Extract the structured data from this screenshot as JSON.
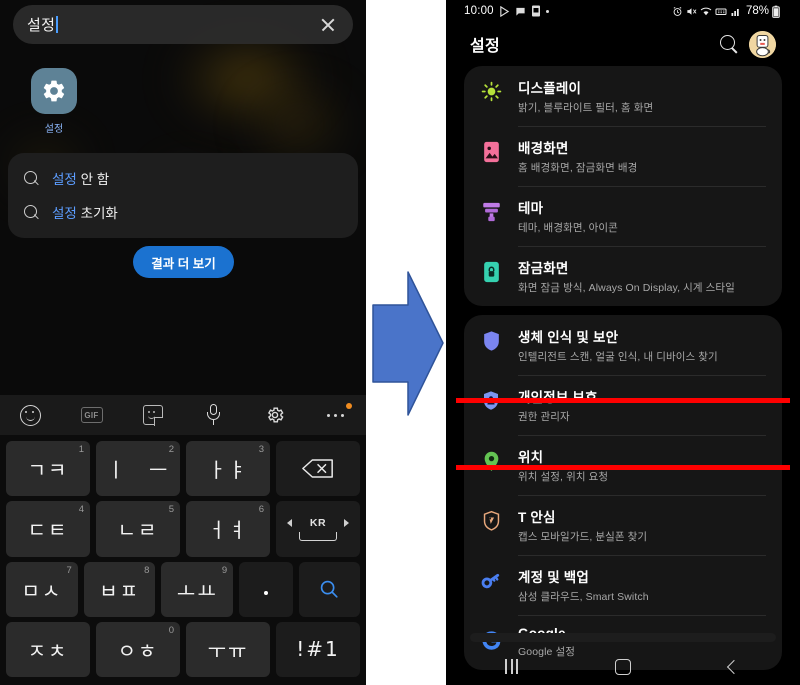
{
  "left_panel": {
    "search": {
      "value": "설정",
      "clear_icon": "close-icon"
    },
    "app_result": {
      "label": "설정",
      "icon": "gear-icon"
    },
    "suggestions": [
      {
        "icon": "search-icon",
        "highlight": "설정",
        "rest": " 안 함"
      },
      {
        "icon": "search-icon",
        "highlight": "설정",
        "rest": " 초기화"
      }
    ],
    "more_button": "결과 더 보기",
    "toolbar": [
      {
        "icon": "emoji-smile-icon",
        "label": ""
      },
      {
        "icon": "gif-icon",
        "label": "GIF"
      },
      {
        "icon": "sticker-icon",
        "label": ""
      },
      {
        "icon": "microphone-icon",
        "label": ""
      },
      {
        "icon": "gear-icon",
        "label": ""
      },
      {
        "icon": "more-options-icon",
        "label": ""
      }
    ],
    "keyboard": {
      "rows": [
        [
          {
            "glyph": "ㄱㅋ",
            "num": "1",
            "type": "char"
          },
          {
            "glyph": "ㅣ　ㅡ",
            "num": "2",
            "type": "char"
          },
          {
            "glyph": "ㅏㅑ",
            "num": "3",
            "type": "char"
          },
          {
            "glyph": "",
            "num": "",
            "type": "backspace"
          }
        ],
        [
          {
            "glyph": "ㄷㅌ",
            "num": "4",
            "type": "char"
          },
          {
            "glyph": "ㄴㄹ",
            "num": "5",
            "type": "char"
          },
          {
            "glyph": "ㅓㅕ",
            "num": "6",
            "type": "char"
          },
          {
            "glyph": "KR",
            "num": "",
            "type": "space"
          }
        ],
        [
          {
            "glyph": "ㅁㅅ",
            "num": "7",
            "type": "char"
          },
          {
            "glyph": "ㅂㅍ",
            "num": "8",
            "type": "char"
          },
          {
            "glyph": "ㅗㅛ",
            "num": "9",
            "type": "char"
          },
          {
            "glyph": ".",
            "num": "",
            "type": "period"
          },
          {
            "glyph": "",
            "num": "",
            "type": "search"
          }
        ],
        [
          {
            "glyph": "ㅈㅊ",
            "num": "",
            "type": "char"
          },
          {
            "glyph": "ㅇㅎ",
            "num": "0",
            "type": "char"
          },
          {
            "glyph": "ㅜㅠ",
            "num": "",
            "type": "char"
          },
          {
            "glyph": "!#1",
            "num": "",
            "type": "symbols"
          }
        ]
      ]
    }
  },
  "arrow": {
    "name": "right-arrow",
    "color": "#4a74c9"
  },
  "right_panel": {
    "status_bar": {
      "time": "10:00",
      "left_icons": [
        "play-store-icon",
        "message-icon",
        "sim-card-icon",
        "dot-icon"
      ],
      "right_icons": [
        "alarm-icon",
        "mute-icon",
        "wifi-icon",
        "network-icon",
        "signal-icon"
      ],
      "battery_percent": "78%",
      "battery_icon": "battery-icon"
    },
    "header": {
      "title": "설정",
      "search_icon": "search-icon",
      "avatar": "user-avatar"
    },
    "groups": [
      {
        "items": [
          {
            "icon": "brightness-icon",
            "color": "#b6e23a",
            "title": "디스플레이",
            "subtitle": "밝기, 블루라이트 필터, 홈 화면"
          },
          {
            "icon": "wallpaper-icon",
            "color": "#f4709a",
            "title": "배경화면",
            "subtitle": "홈 배경화면, 잠금화면 배경"
          },
          {
            "icon": "theme-icon",
            "color": "#c07be8",
            "title": "테마",
            "subtitle": "테마, 배경화면, 아이콘"
          },
          {
            "icon": "lock-icon",
            "color": "#35d1b0",
            "title": "잠금화면",
            "subtitle": "화면 잠금 방식, Always On Display, 시계 스타일"
          }
        ]
      },
      {
        "items": [
          {
            "icon": "shield-icon",
            "color": "#7b85f0",
            "title": "생체 인식 및 보안",
            "subtitle": "인텔리전트 스캔, 얼굴 인식, 내 디바이스 찾기"
          },
          {
            "icon": "privacy-shield-icon",
            "color": "#7b95f0",
            "title": "개인정보 보호",
            "subtitle": "권한 관리자"
          },
          {
            "icon": "location-pin-icon",
            "color": "#63c452",
            "title": "위치",
            "subtitle": "위치 설정, 위치 요청",
            "highlighted": true
          },
          {
            "icon": "t-safe-shield-icon",
            "color": "#e8a87c",
            "title": "T 안심",
            "subtitle": "캡스 모바일가드, 분실폰 찾기"
          },
          {
            "icon": "key-icon",
            "color": "#4a7ef0",
            "title": "계정 및 백업",
            "subtitle": "삼성 클라우드, Smart Switch"
          },
          {
            "icon": "google-g-icon",
            "color": "#4285f4",
            "title": "Google",
            "subtitle": "Google 설정"
          }
        ]
      }
    ],
    "nav_bar": {
      "recent": "recent-apps-icon",
      "home": "home-icon",
      "back": "back-icon"
    }
  }
}
